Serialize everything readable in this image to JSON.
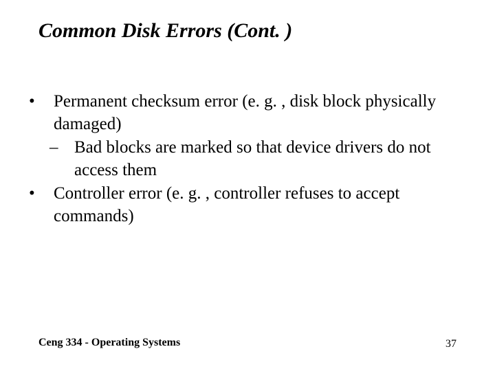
{
  "title": "Common Disk Errors (Cont. )",
  "bullets": {
    "b1": "Permanent checksum error (e. g. , disk block physically damaged)",
    "b1_1": "Bad blocks are marked so that device drivers do not access them",
    "b2": "Controller error (e. g. , controller refuses to accept commands)"
  },
  "footer": "Ceng 334 - Operating Systems",
  "page_number": "37"
}
